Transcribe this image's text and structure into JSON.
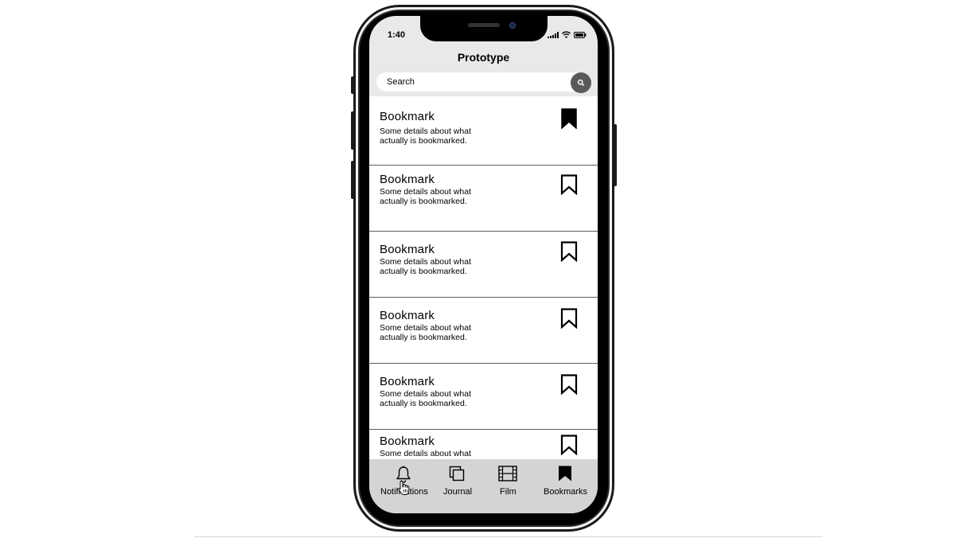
{
  "status_bar": {
    "time": "1:40"
  },
  "header": {
    "title": "Prototype"
  },
  "search": {
    "placeholder": "Search"
  },
  "bookmarks": [
    {
      "title": "Bookmark",
      "description": "Some details about what actually is bookmarked.",
      "saved": true
    },
    {
      "title": "Bookmark",
      "description": "Some details about what actually is bookmarked.",
      "saved": false
    },
    {
      "title": "Bookmark",
      "description": "Some details about what actually is bookmarked.",
      "saved": false
    },
    {
      "title": "Bookmark",
      "description": "Some details about what actually is bookmarked.",
      "saved": false
    },
    {
      "title": "Bookmark",
      "description": "Some details about what actually is bookmarked.",
      "saved": false
    },
    {
      "title": "Bookmark",
      "description": "Some details about what",
      "saved": false
    }
  ],
  "tab_bar": {
    "tabs": [
      {
        "label": "Notifications",
        "icon": "bell-icon"
      },
      {
        "label": "Journal",
        "icon": "copy-icon"
      },
      {
        "label": "Film",
        "icon": "film-icon"
      },
      {
        "label": "Bookmarks",
        "icon": "bookmark-filled-icon"
      }
    ],
    "active": "Bookmarks"
  }
}
